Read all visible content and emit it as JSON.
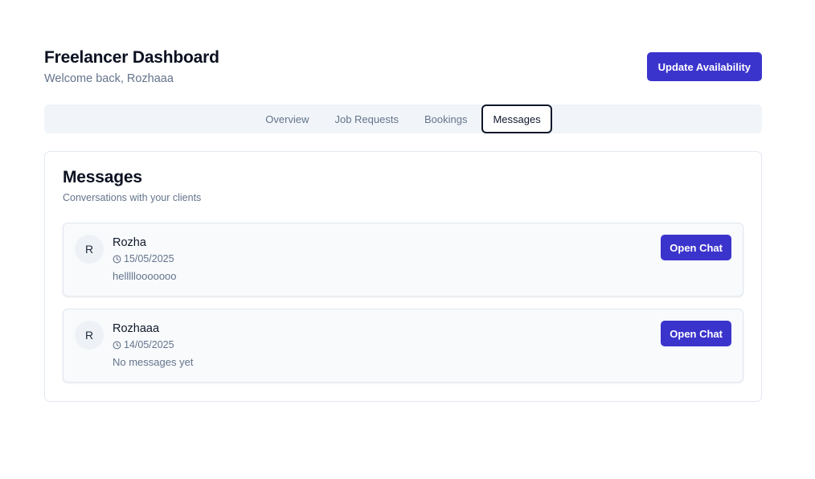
{
  "header": {
    "title": "Freelancer Dashboard",
    "subtitle": "Welcome back, Rozhaaa",
    "action_label": "Update Availability"
  },
  "tabs": [
    {
      "label": "Overview",
      "active": false
    },
    {
      "label": "Job Requests",
      "active": false
    },
    {
      "label": "Bookings",
      "active": false
    },
    {
      "label": "Messages",
      "active": true
    }
  ],
  "messages_card": {
    "title": "Messages",
    "description": "Conversations with your clients",
    "conversations": [
      {
        "avatar_initial": "R",
        "name": "Rozha",
        "date": "15/05/2025",
        "preview": "helllllooooooo",
        "action_label": "Open Chat"
      },
      {
        "avatar_initial": "R",
        "name": "Rozhaaa",
        "date": "14/05/2025",
        "preview": "No messages yet",
        "action_label": "Open Chat"
      }
    ]
  },
  "colors": {
    "primary": "#3b34cc",
    "muted_text": "#64748b",
    "tab_bar_bg": "#f1f5f9",
    "border": "#e2e8f0"
  },
  "icons": {
    "date_icon": "clock-icon"
  }
}
